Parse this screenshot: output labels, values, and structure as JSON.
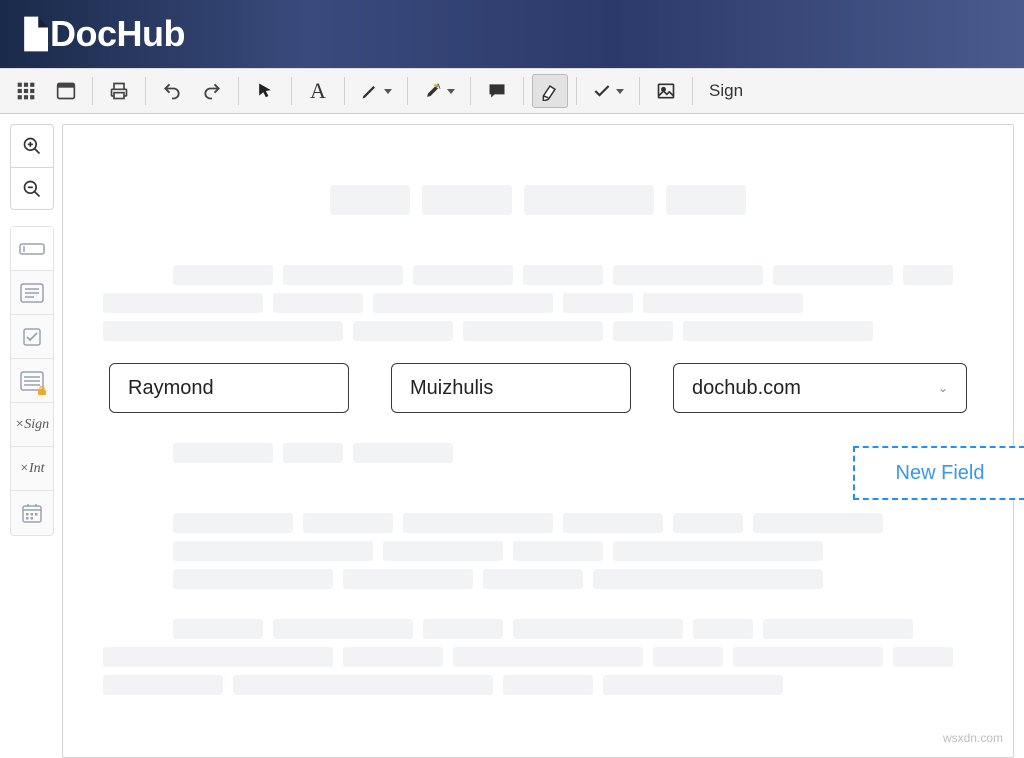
{
  "app": {
    "name": "DocHub"
  },
  "toolbar": {
    "sign_label": "Sign"
  },
  "form": {
    "first_name": "Raymond",
    "last_name": "Muizhulis",
    "domain": "dochub.com"
  },
  "floating": {
    "new_field_label": "New Field"
  },
  "watermark": "wsxdn.com"
}
